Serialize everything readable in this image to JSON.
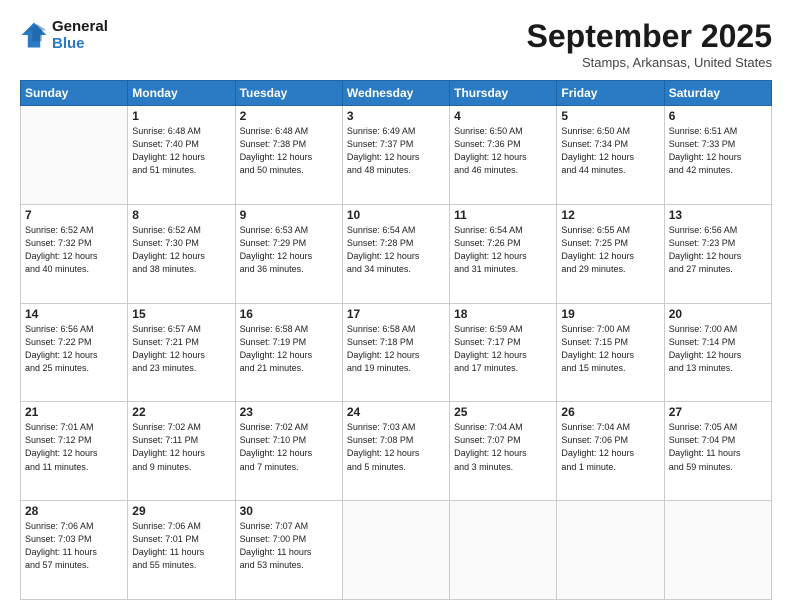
{
  "logo": {
    "line1": "General",
    "line2": "Blue"
  },
  "title": "September 2025",
  "subtitle": "Stamps, Arkansas, United States",
  "headers": [
    "Sunday",
    "Monday",
    "Tuesday",
    "Wednesday",
    "Thursday",
    "Friday",
    "Saturday"
  ],
  "weeks": [
    [
      {
        "day": "",
        "info": ""
      },
      {
        "day": "1",
        "info": "Sunrise: 6:48 AM\nSunset: 7:40 PM\nDaylight: 12 hours\nand 51 minutes."
      },
      {
        "day": "2",
        "info": "Sunrise: 6:48 AM\nSunset: 7:38 PM\nDaylight: 12 hours\nand 50 minutes."
      },
      {
        "day": "3",
        "info": "Sunrise: 6:49 AM\nSunset: 7:37 PM\nDaylight: 12 hours\nand 48 minutes."
      },
      {
        "day": "4",
        "info": "Sunrise: 6:50 AM\nSunset: 7:36 PM\nDaylight: 12 hours\nand 46 minutes."
      },
      {
        "day": "5",
        "info": "Sunrise: 6:50 AM\nSunset: 7:34 PM\nDaylight: 12 hours\nand 44 minutes."
      },
      {
        "day": "6",
        "info": "Sunrise: 6:51 AM\nSunset: 7:33 PM\nDaylight: 12 hours\nand 42 minutes."
      }
    ],
    [
      {
        "day": "7",
        "info": "Sunrise: 6:52 AM\nSunset: 7:32 PM\nDaylight: 12 hours\nand 40 minutes."
      },
      {
        "day": "8",
        "info": "Sunrise: 6:52 AM\nSunset: 7:30 PM\nDaylight: 12 hours\nand 38 minutes."
      },
      {
        "day": "9",
        "info": "Sunrise: 6:53 AM\nSunset: 7:29 PM\nDaylight: 12 hours\nand 36 minutes."
      },
      {
        "day": "10",
        "info": "Sunrise: 6:54 AM\nSunset: 7:28 PM\nDaylight: 12 hours\nand 34 minutes."
      },
      {
        "day": "11",
        "info": "Sunrise: 6:54 AM\nSunset: 7:26 PM\nDaylight: 12 hours\nand 31 minutes."
      },
      {
        "day": "12",
        "info": "Sunrise: 6:55 AM\nSunset: 7:25 PM\nDaylight: 12 hours\nand 29 minutes."
      },
      {
        "day": "13",
        "info": "Sunrise: 6:56 AM\nSunset: 7:23 PM\nDaylight: 12 hours\nand 27 minutes."
      }
    ],
    [
      {
        "day": "14",
        "info": "Sunrise: 6:56 AM\nSunset: 7:22 PM\nDaylight: 12 hours\nand 25 minutes."
      },
      {
        "day": "15",
        "info": "Sunrise: 6:57 AM\nSunset: 7:21 PM\nDaylight: 12 hours\nand 23 minutes."
      },
      {
        "day": "16",
        "info": "Sunrise: 6:58 AM\nSunset: 7:19 PM\nDaylight: 12 hours\nand 21 minutes."
      },
      {
        "day": "17",
        "info": "Sunrise: 6:58 AM\nSunset: 7:18 PM\nDaylight: 12 hours\nand 19 minutes."
      },
      {
        "day": "18",
        "info": "Sunrise: 6:59 AM\nSunset: 7:17 PM\nDaylight: 12 hours\nand 17 minutes."
      },
      {
        "day": "19",
        "info": "Sunrise: 7:00 AM\nSunset: 7:15 PM\nDaylight: 12 hours\nand 15 minutes."
      },
      {
        "day": "20",
        "info": "Sunrise: 7:00 AM\nSunset: 7:14 PM\nDaylight: 12 hours\nand 13 minutes."
      }
    ],
    [
      {
        "day": "21",
        "info": "Sunrise: 7:01 AM\nSunset: 7:12 PM\nDaylight: 12 hours\nand 11 minutes."
      },
      {
        "day": "22",
        "info": "Sunrise: 7:02 AM\nSunset: 7:11 PM\nDaylight: 12 hours\nand 9 minutes."
      },
      {
        "day": "23",
        "info": "Sunrise: 7:02 AM\nSunset: 7:10 PM\nDaylight: 12 hours\nand 7 minutes."
      },
      {
        "day": "24",
        "info": "Sunrise: 7:03 AM\nSunset: 7:08 PM\nDaylight: 12 hours\nand 5 minutes."
      },
      {
        "day": "25",
        "info": "Sunrise: 7:04 AM\nSunset: 7:07 PM\nDaylight: 12 hours\nand 3 minutes."
      },
      {
        "day": "26",
        "info": "Sunrise: 7:04 AM\nSunset: 7:06 PM\nDaylight: 12 hours\nand 1 minute."
      },
      {
        "day": "27",
        "info": "Sunrise: 7:05 AM\nSunset: 7:04 PM\nDaylight: 11 hours\nand 59 minutes."
      }
    ],
    [
      {
        "day": "28",
        "info": "Sunrise: 7:06 AM\nSunset: 7:03 PM\nDaylight: 11 hours\nand 57 minutes."
      },
      {
        "day": "29",
        "info": "Sunrise: 7:06 AM\nSunset: 7:01 PM\nDaylight: 11 hours\nand 55 minutes."
      },
      {
        "day": "30",
        "info": "Sunrise: 7:07 AM\nSunset: 7:00 PM\nDaylight: 11 hours\nand 53 minutes."
      },
      {
        "day": "",
        "info": ""
      },
      {
        "day": "",
        "info": ""
      },
      {
        "day": "",
        "info": ""
      },
      {
        "day": "",
        "info": ""
      }
    ]
  ]
}
